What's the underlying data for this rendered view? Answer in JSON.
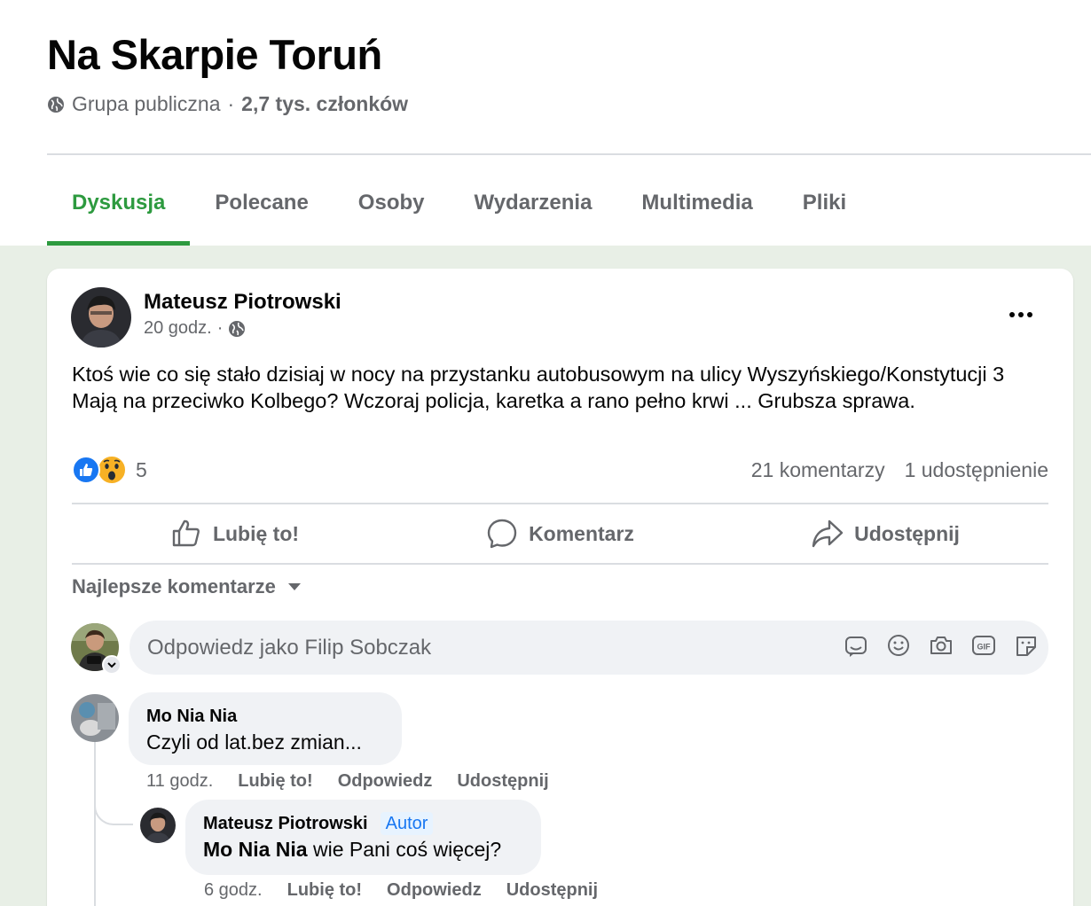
{
  "group": {
    "title": "Na Skarpie Toruń",
    "privacy": "Grupa publiczna",
    "separator": "·",
    "members": "2,7 tys. członków"
  },
  "tabs": [
    {
      "label": "Dyskusja",
      "active": true
    },
    {
      "label": "Polecane",
      "active": false
    },
    {
      "label": "Osoby",
      "active": false
    },
    {
      "label": "Wydarzenia",
      "active": false
    },
    {
      "label": "Multimedia",
      "active": false
    },
    {
      "label": "Pliki",
      "active": false
    }
  ],
  "post": {
    "author": "Mateusz Piotrowski",
    "time": "20 godz.",
    "dot": "·",
    "text": "Ktoś wie co się stało dzisiaj w nocy na przystanku autobusowym na ulicy Wyszyńskiego/Konstytucji 3 Mają na przeciwko Kolbego? Wczoraj policja, karetka  a rano pełno krwi ... Grubsza sprawa.",
    "reaction_count": "5",
    "comments_count": "21 komentarzy",
    "shares_count": "1 udostępnienie"
  },
  "actions": {
    "like": "Lubię to!",
    "comment": "Komentarz",
    "share": "Udostępnij"
  },
  "comments_sort": "Najlepsze komentarze",
  "reply_box": {
    "placeholder": "Odpowiedz jako Filip Sobczak"
  },
  "comments": [
    {
      "name": "Mo Nia Nia",
      "text": "Czyli od lat.bez zmian...",
      "time": "11 godz.",
      "like": "Lubię to!",
      "reply": "Odpowiedz",
      "share": "Udostępnij"
    },
    {
      "name": "Mateusz Piotrowski",
      "badge": "Autor",
      "mention": "Mo Nia Nia",
      "text": " wie Pani coś więcej?",
      "time": "6 godz.",
      "like": "Lubię to!",
      "reply": "Odpowiedz",
      "share": "Udostępnij"
    }
  ],
  "colors": {
    "accent_green": "#2d9a3f",
    "like_blue": "#1877f2",
    "page_bg": "#e8efe6",
    "secondary_text": "#65676b"
  }
}
